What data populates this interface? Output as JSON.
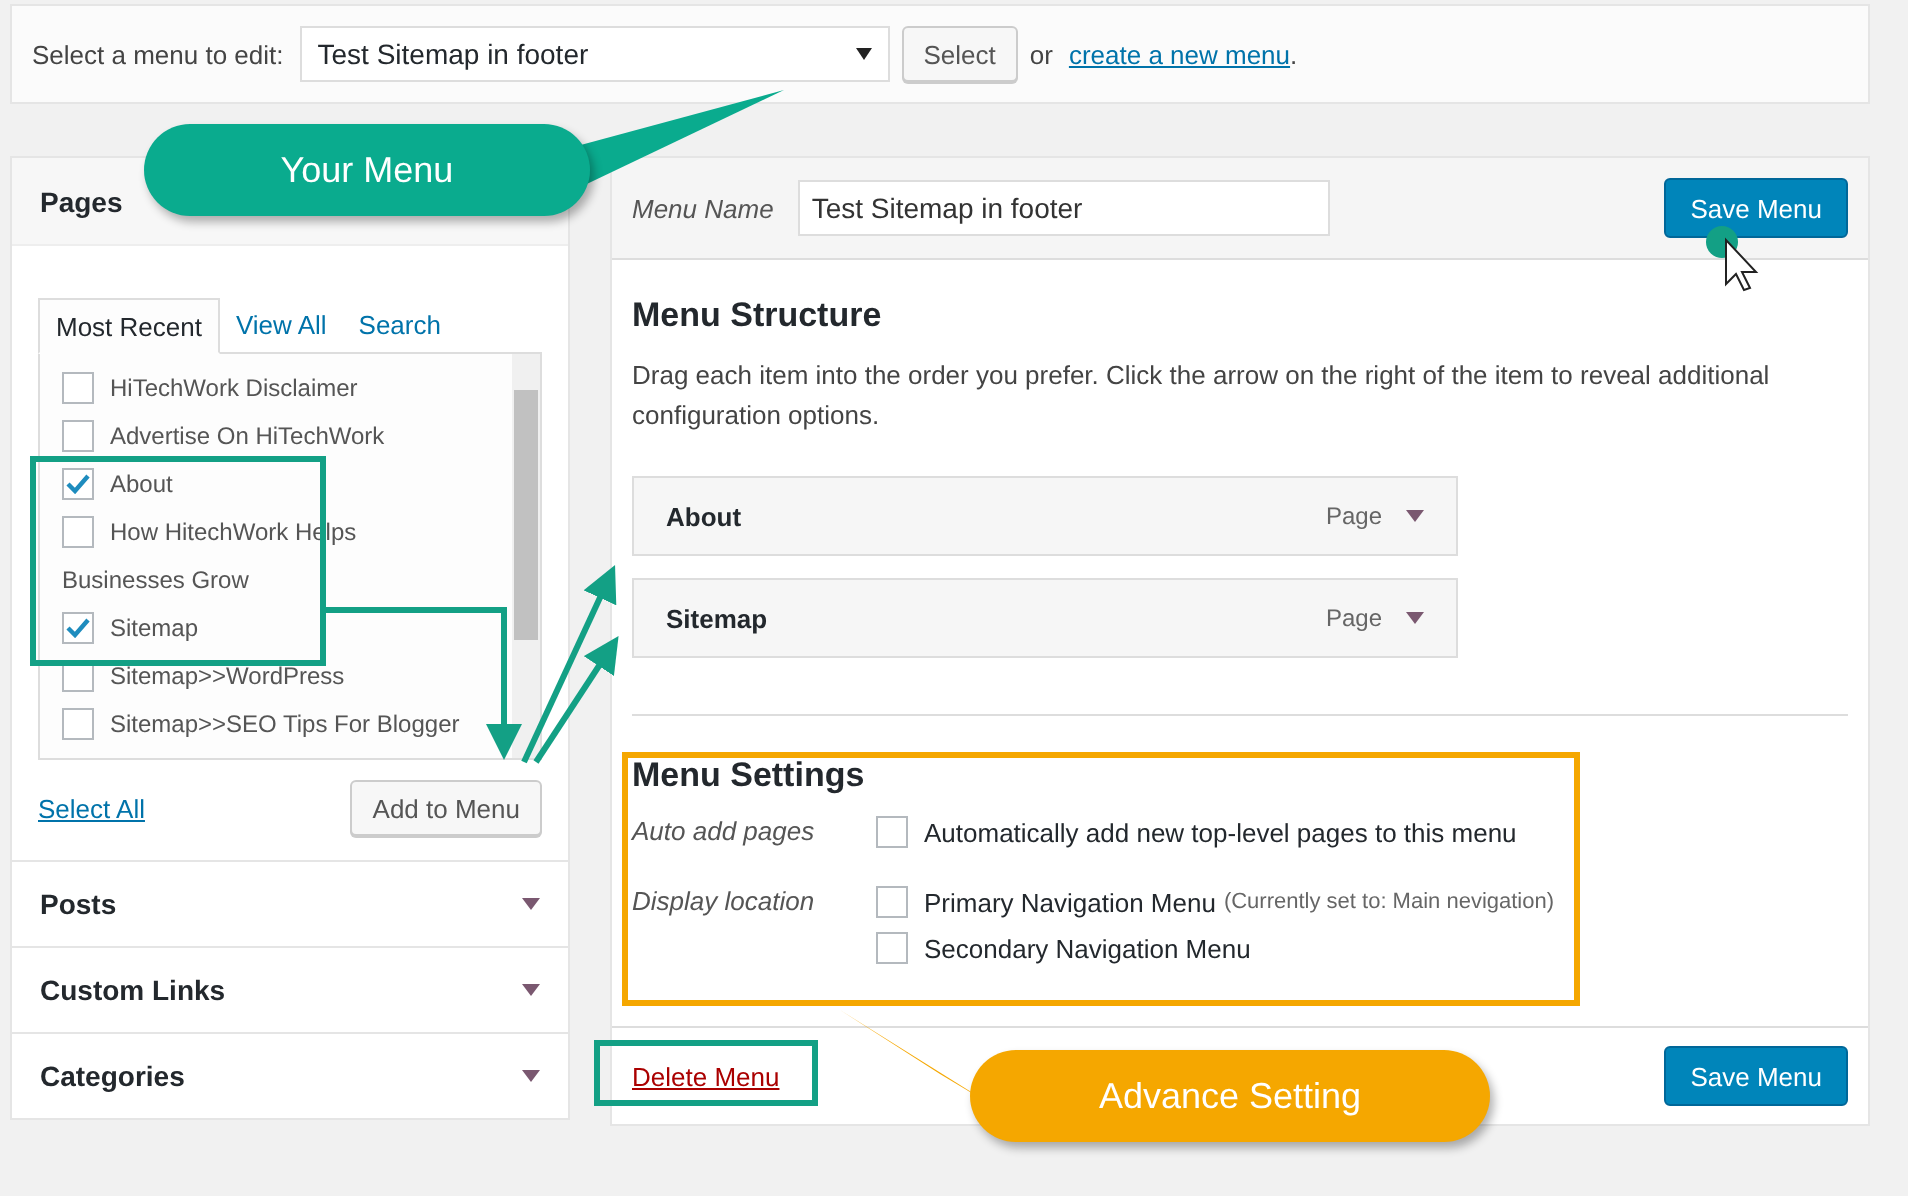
{
  "menu_picker": {
    "label": "Select a menu to edit:",
    "value": "Test Sitemap in footer",
    "button": "Select",
    "or_text": "or",
    "link": "create a new menu",
    "after_link": "."
  },
  "pages_panel": {
    "title": "Pages",
    "tabs": [
      {
        "label": "Most Recent",
        "selected": true
      },
      {
        "label": "View All",
        "selected": false
      },
      {
        "label": "Search",
        "selected": false
      }
    ],
    "items": [
      {
        "label": "HiTechWork Disclaimer",
        "checked": false
      },
      {
        "label": "Advertise On HiTechWork",
        "checked": false
      },
      {
        "label": "About",
        "checked": true
      },
      {
        "label": "How HitechWork Helps",
        "continued": "Businesses Grow",
        "checked": false
      },
      {
        "label": "Sitemap",
        "checked": true
      },
      {
        "label": "Sitemap>>WordPress",
        "checked": false
      },
      {
        "label": "Sitemap>>SEO Tips For Blogger",
        "checked": false
      }
    ],
    "select_all": "Select All",
    "add_button": "Add to Menu"
  },
  "accordions": [
    {
      "title": "Posts"
    },
    {
      "title": "Custom Links"
    },
    {
      "title": "Categories"
    }
  ],
  "menu_editor": {
    "name_label": "Menu Name",
    "name_value": "Test Sitemap in footer",
    "save_button": "Save Menu",
    "structure_title": "Menu Structure",
    "structure_hint": "Drag each item into the order you prefer. Click the arrow on the right of the item to reveal additional configuration options.",
    "items": [
      {
        "title": "About",
        "type": "Page"
      },
      {
        "title": "Sitemap",
        "type": "Page"
      }
    ],
    "settings_title": "Menu Settings",
    "settings": [
      {
        "label": "Auto add pages",
        "options": [
          {
            "label": "Automatically add new top-level pages to this menu",
            "checked": false
          }
        ]
      },
      {
        "label": "Display location",
        "options": [
          {
            "label": "Primary Navigation Menu",
            "note": "(Currently set to: Main nevigation)",
            "checked": false
          },
          {
            "label": "Secondary Navigation Menu",
            "checked": false
          }
        ]
      }
    ],
    "delete_link": "Delete Menu",
    "footer_save_button": "Save Menu"
  },
  "callouts": [
    {
      "text": "Your Menu",
      "color": "#0aab8e"
    },
    {
      "text": "Advance Setting",
      "color": "#f5a700"
    }
  ]
}
